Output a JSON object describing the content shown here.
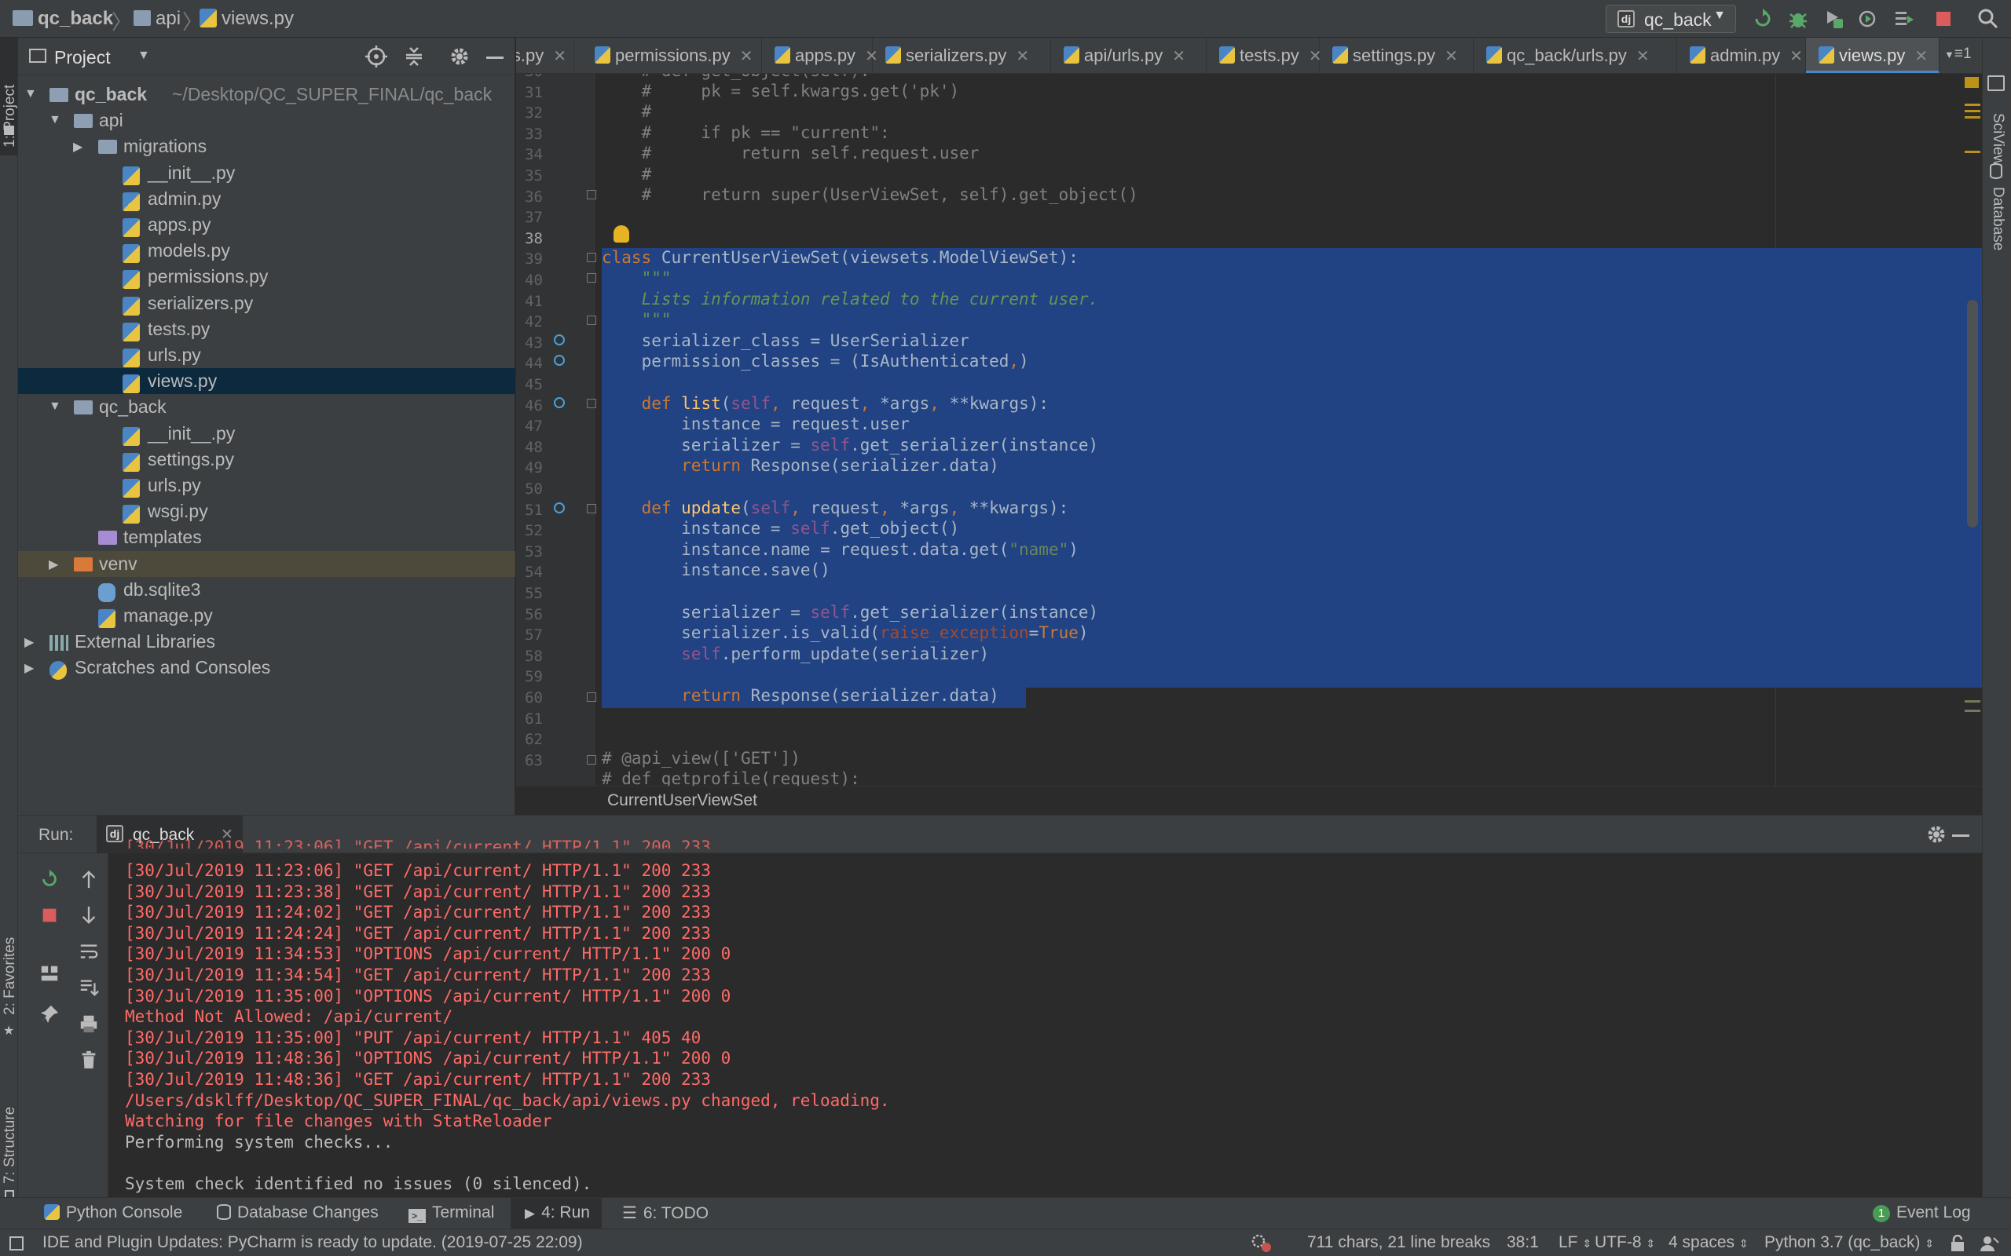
{
  "navbar": {
    "breadcrumb": [
      "qc_back",
      "api",
      "views.py"
    ],
    "run_config": "qc_back"
  },
  "left_stripe": {
    "project_tab": "1: Project",
    "favorites_tab": "2: Favorites",
    "structure_tab": "7: Structure"
  },
  "right_stripe": {
    "sciview_tab": "SciView",
    "database_tab": "Database"
  },
  "project_panel": {
    "title": "Project",
    "tree": [
      {
        "label": "qc_back",
        "extra": "~/Desktop/QC_SUPER_FINAL/qc_back",
        "indent": 0,
        "icon": "folder",
        "expanded": true
      },
      {
        "label": "api",
        "indent": 1,
        "icon": "package-folder",
        "expanded": true
      },
      {
        "label": "migrations",
        "indent": 2,
        "icon": "package-folder",
        "expanded": false
      },
      {
        "label": "__init__.py",
        "indent": 3,
        "icon": "python-file"
      },
      {
        "label": "admin.py",
        "indent": 3,
        "icon": "python-file"
      },
      {
        "label": "apps.py",
        "indent": 3,
        "icon": "python-file"
      },
      {
        "label": "models.py",
        "indent": 3,
        "icon": "python-file"
      },
      {
        "label": "permissions.py",
        "indent": 3,
        "icon": "python-file"
      },
      {
        "label": "serializers.py",
        "indent": 3,
        "icon": "python-file"
      },
      {
        "label": "tests.py",
        "indent": 3,
        "icon": "python-file"
      },
      {
        "label": "urls.py",
        "indent": 3,
        "icon": "python-file"
      },
      {
        "label": "views.py",
        "indent": 3,
        "icon": "python-file",
        "selected": true
      },
      {
        "label": "qc_back",
        "indent": 1,
        "icon": "package-folder",
        "expanded": true
      },
      {
        "label": "__init__.py",
        "indent": 3,
        "icon": "python-file"
      },
      {
        "label": "settings.py",
        "indent": 3,
        "icon": "python-file"
      },
      {
        "label": "urls.py",
        "indent": 3,
        "icon": "python-file"
      },
      {
        "label": "wsgi.py",
        "indent": 3,
        "icon": "python-file"
      },
      {
        "label": "templates",
        "indent": 2,
        "icon": "templates-folder"
      },
      {
        "label": "venv",
        "indent": 1,
        "icon": "excluded-folder",
        "expanded": false,
        "venv": true
      },
      {
        "label": "db.sqlite3",
        "indent": 2,
        "icon": "database-file"
      },
      {
        "label": "manage.py",
        "indent": 2,
        "icon": "python-file"
      },
      {
        "label": "External Libraries",
        "indent": 0,
        "icon": "library-icon",
        "expanded": false
      },
      {
        "label": "Scratches and Consoles",
        "indent": 0,
        "icon": "scratches-icon",
        "expanded": false
      }
    ]
  },
  "editor_tabs": [
    {
      "label": "ls.py"
    },
    {
      "label": "permissions.py"
    },
    {
      "label": "apps.py"
    },
    {
      "label": "serializers.py"
    },
    {
      "label": "api/urls.py"
    },
    {
      "label": "tests.py"
    },
    {
      "label": "settings.py"
    },
    {
      "label": "qc_back/urls.py"
    },
    {
      "label": "admin.py"
    },
    {
      "label": "views.py",
      "active": true
    }
  ],
  "tab_overflow": "1",
  "editor": {
    "line_numbers": [
      "30",
      "31",
      "32",
      "33",
      "34",
      "35",
      "36",
      "37",
      "38",
      "39",
      "40",
      "41",
      "42",
      "43",
      "44",
      "45",
      "46",
      "47",
      "48",
      "49",
      "50",
      "51",
      "52",
      "53",
      "54",
      "55",
      "56",
      "57",
      "58",
      "59",
      "60",
      "61",
      "62",
      "63"
    ],
    "top_partial_line": "    # def get_object(self):",
    "breadcrumb": "CurrentUserViewSet"
  },
  "run_panel": {
    "label": "Run:",
    "tab": "qc_back",
    "log_lines": [
      {
        "text": "[30/Jul/2019 11:23:06] \"GET /api/current/ HTTP/1.1\" 200 233",
        "color": "red"
      },
      {
        "text": "[30/Jul/2019 11:23:38] \"GET /api/current/ HTTP/1.1\" 200 233",
        "color": "red"
      },
      {
        "text": "[30/Jul/2019 11:24:02] \"GET /api/current/ HTTP/1.1\" 200 233",
        "color": "red"
      },
      {
        "text": "[30/Jul/2019 11:24:24] \"GET /api/current/ HTTP/1.1\" 200 233",
        "color": "red"
      },
      {
        "text": "[30/Jul/2019 11:34:53] \"OPTIONS /api/current/ HTTP/1.1\" 200 0",
        "color": "red"
      },
      {
        "text": "[30/Jul/2019 11:34:54] \"GET /api/current/ HTTP/1.1\" 200 233",
        "color": "red"
      },
      {
        "text": "[30/Jul/2019 11:35:00] \"OPTIONS /api/current/ HTTP/1.1\" 200 0",
        "color": "red"
      },
      {
        "text": "Method Not Allowed: /api/current/",
        "color": "red"
      },
      {
        "text": "[30/Jul/2019 11:35:00] \"PUT /api/current/ HTTP/1.1\" 405 40",
        "color": "red"
      },
      {
        "text": "[30/Jul/2019 11:48:36] \"OPTIONS /api/current/ HTTP/1.1\" 200 0",
        "color": "red"
      },
      {
        "text": "[30/Jul/2019 11:48:36] \"GET /api/current/ HTTP/1.1\" 200 233",
        "color": "red"
      },
      {
        "text": "/Users/dsklff/Desktop/QC_SUPER_FINAL/qc_back/api/views.py changed, reloading.",
        "color": "red"
      },
      {
        "text": "Watching for file changes with StatReloader",
        "color": "red"
      },
      {
        "text": "Performing system checks...",
        "color": "gray"
      },
      {
        "text": "",
        "color": "gray"
      },
      {
        "text": "System check identified no issues (0 silenced).",
        "color": "gray"
      }
    ]
  },
  "bottom_tools": {
    "python_console": "Python Console",
    "database_changes": "Database Changes",
    "terminal": "Terminal",
    "run": "4: Run",
    "todo": "6: TODO",
    "event_log_count": "1",
    "event_log": "Event Log"
  },
  "status_bar": {
    "message": "IDE and Plugin Updates: PyCharm is ready to update. (2019-07-25 22:09)",
    "chars": "711 chars, 21 line breaks",
    "position": "38:1",
    "line_sep": "LF",
    "encoding": "UTF-8",
    "indent": "4 spaces",
    "interpreter": "Python 3.7 (qc_back)"
  }
}
